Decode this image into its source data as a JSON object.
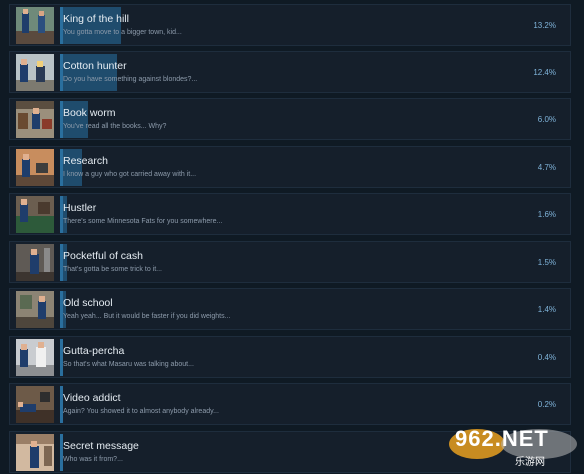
{
  "achievements": [
    {
      "title": "King of the hill",
      "description": "You gotta move to a bigger town, kid...",
      "percent": "13.2%",
      "fill": 0.132
    },
    {
      "title": "Cotton hunter",
      "description": "Do you have something against blondes?...",
      "percent": "12.4%",
      "fill": 0.124
    },
    {
      "title": "Book worm",
      "description": "You've read all the books... Why?",
      "percent": "6.0%",
      "fill": 0.06
    },
    {
      "title": "Research",
      "description": "I know a guy who got carried away with it...",
      "percent": "4.7%",
      "fill": 0.047
    },
    {
      "title": "Hustler",
      "description": "There's some Minnesota Fats for you somewhere...",
      "percent": "1.6%",
      "fill": 0.016
    },
    {
      "title": "Pocketful of cash",
      "description": "That's gotta be some trick to it...",
      "percent": "1.5%",
      "fill": 0.015
    },
    {
      "title": "Old school",
      "description": "Yeah yeah... But it would be faster if you did weights...",
      "percent": "1.4%",
      "fill": 0.014
    },
    {
      "title": "Gutta-percha",
      "description": "So that's what Masaru was talking about...",
      "percent": "0.4%",
      "fill": 0.004
    },
    {
      "title": "Video addict",
      "description": "Again? You showed it to almost anybody already...",
      "percent": "0.2%",
      "fill": 0.002
    },
    {
      "title": "Secret message",
      "description": "Who was it from?...",
      "percent": "",
      "fill": 0
    }
  ],
  "watermark": {
    "text": "962.NET",
    "sub": "乐游网"
  },
  "colors": {
    "background": "#0f1a24",
    "row": "#151f2b",
    "bar_fill": "#1f4c6d",
    "bar_edge": "#2a6f9e",
    "title": "#e6edf3",
    "description": "#8d9bab",
    "percent": "#7fb3d9"
  }
}
